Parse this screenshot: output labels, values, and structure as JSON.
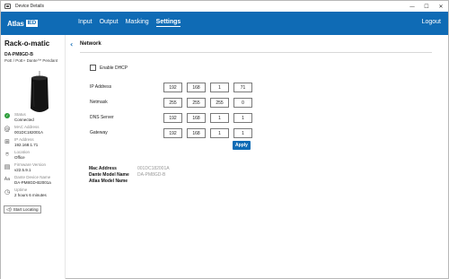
{
  "window": {
    "title": "Device Details",
    "controls": [
      "—",
      "☐",
      "✕"
    ]
  },
  "brand": {
    "logo_text": "AtlasIED",
    "logo_box": "IED",
    "color": "#0f6bb5"
  },
  "nav": {
    "tabs": [
      {
        "label": "Input",
        "active": false
      },
      {
        "label": "Output",
        "active": false
      },
      {
        "label": "Masking",
        "active": false
      },
      {
        "label": "Settings",
        "active": true
      }
    ],
    "logout": "Logout"
  },
  "sidebar": {
    "device_name": "Rack-o-matic",
    "model": "DA-PM8GD-B",
    "description": "PoE / PoE+ Dante™ Pendant",
    "info": [
      {
        "icon": "check-circle-icon",
        "label": "Status",
        "value": "Connected"
      },
      {
        "icon": "at-sign-icon",
        "label": "MAC Address",
        "value": "001DC182001A"
      },
      {
        "icon": "network-icon",
        "label": "IP Address",
        "value": "192.168.1.71"
      },
      {
        "icon": "location-pin-icon",
        "label": "Location",
        "value": "Office"
      },
      {
        "icon": "firmware-icon",
        "label": "Firmware Version",
        "value": "v22.5.9.1"
      },
      {
        "icon": "text-icon",
        "label": "Dante Device Name",
        "value": "DA-PM8GD-B2001a"
      },
      {
        "icon": "clock-icon",
        "label": "Uptime",
        "value": "2 hours 6 minutes"
      }
    ],
    "start_locating": "Start Locating",
    "status_color": "#2e9e3c"
  },
  "main": {
    "section_title": "Network",
    "dhcp_label": "Enable DHCP",
    "dhcp_checked": false,
    "rows": [
      {
        "label": "IP Address",
        "octets": [
          "192",
          "168",
          "1",
          "71"
        ]
      },
      {
        "label": "Netmask",
        "octets": [
          "255",
          "255",
          "255",
          "0"
        ]
      },
      {
        "label": "DNS Server",
        "octets": [
          "192",
          "168",
          "1",
          "1"
        ]
      },
      {
        "label": "Gateway",
        "octets": [
          "192",
          "168",
          "1",
          "1"
        ]
      }
    ],
    "apply_label": "Apply",
    "meta": [
      {
        "key": "Mac Address",
        "value": "001DC182001A"
      },
      {
        "key": "Dante Model Name",
        "value": "DA-PM8GD-B"
      },
      {
        "key": "Atlas Model Name",
        "value": ""
      }
    ]
  }
}
